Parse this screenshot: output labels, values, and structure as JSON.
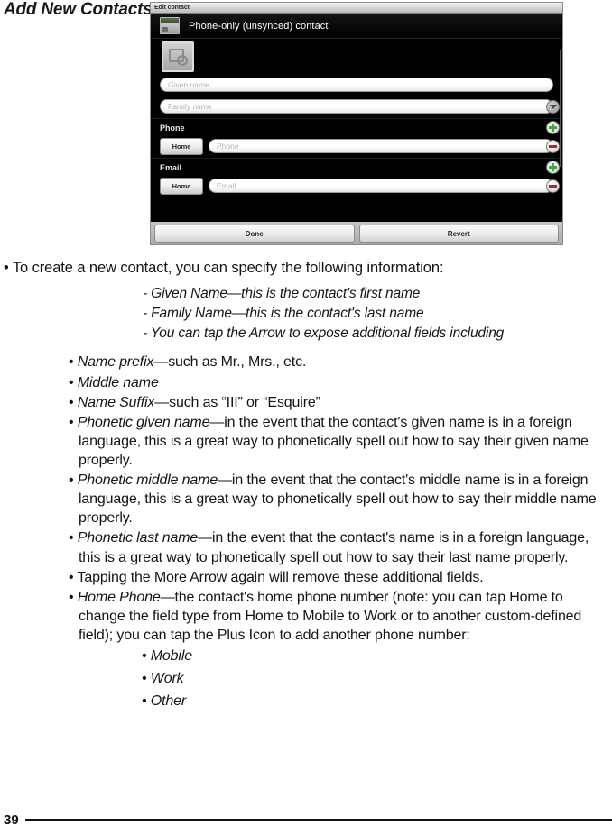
{
  "page": {
    "heading": "Add New Contacts",
    "folio": "39"
  },
  "screenshot": {
    "window_title": "Edit contact",
    "account_bar": {
      "icon": "contact-account-icon",
      "label": "Phone-only (unsynced) contact"
    },
    "photo_placeholder_icon": "add-photo-icon",
    "fields": [
      {
        "name": "given-name",
        "placeholder": "Given name",
        "value": ""
      },
      {
        "name": "family-name",
        "placeholder": "Family name",
        "value": ""
      }
    ],
    "more_arrow_icon": "chevron-down-icon",
    "sections": [
      {
        "title": "Phone",
        "add_icon": "plus-icon",
        "type_button": "Home",
        "placeholder": "Phone",
        "value": "",
        "remove_icon": "minus-icon"
      },
      {
        "title": "Email",
        "add_icon": "plus-icon",
        "type_button": "Home",
        "placeholder": "Email",
        "value": "",
        "remove_icon": "minus-icon"
      }
    ],
    "buttons": {
      "done": "Done",
      "revert": "Revert"
    },
    "colors": {
      "plus": "#3da93d",
      "minus": "#a42b3c",
      "background": "#000000",
      "titlebar": "#d9d9d9"
    }
  },
  "body": {
    "lede": "• To create a new contact, you can specify the following information:",
    "dash_items": [
      "- Given Name—this is the contact's first name",
      "- Family Name—this is the contact's last name",
      "- You can tap the Arrow to expose additional fields including"
    ],
    "bullets": [
      {
        "lead": "Name prefix",
        "rest": "—such as Mr., Mrs., etc."
      },
      {
        "lead": "Middle name",
        "rest": ""
      },
      {
        "lead": "Name Suffix",
        "rest": "—such as “III” or “Esquire”"
      },
      {
        "lead": "Phonetic given name",
        "rest": "—in the event that the contact's given name is in a foreign language, this is a great way to phonetically spell out how to say their given name properly."
      },
      {
        "lead": "Phonetic middle name",
        "rest": "—in the event that the contact's middle name is in a foreign language, this is a great way to phonetically spell out how to say their middle name properly."
      },
      {
        "lead": "Phonetic last name",
        "rest": "—in the event that the contact's name is in a foreign language, this is a great way to phonetically spell out how to say their last name properly."
      },
      {
        "lead": "",
        "rest": "Tapping the More Arrow again will remove these additional fields."
      },
      {
        "lead": "Home Phone",
        "rest": "—the contact's home phone number (note: you can tap Home to change the field type from Home to Mobile to Work or to another custom-defined field); you can tap the Plus Icon to add another phone number:"
      }
    ],
    "phone_types": [
      "• Mobile",
      "• Work",
      "• Other"
    ]
  }
}
